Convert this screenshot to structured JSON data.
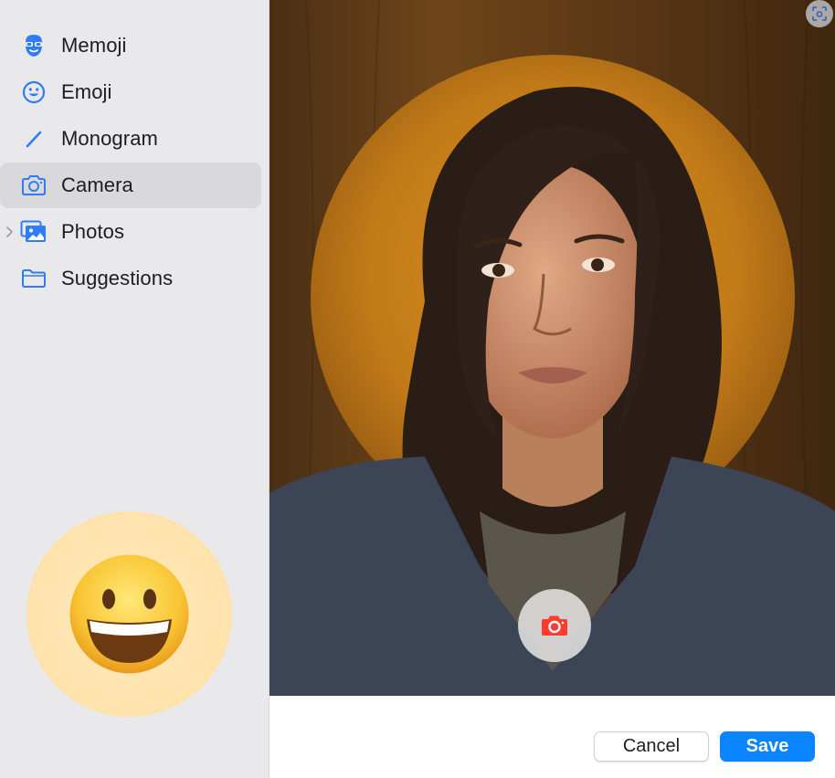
{
  "sidebar": {
    "items": [
      {
        "label": "Memoji",
        "icon": "memoji-icon"
      },
      {
        "label": "Emoji",
        "icon": "emoji-icon"
      },
      {
        "label": "Monogram",
        "icon": "pencil-icon"
      },
      {
        "label": "Camera",
        "icon": "camera-icon",
        "selected": true
      },
      {
        "label": "Photos",
        "icon": "photos-icon",
        "expandable": true
      },
      {
        "label": "Suggestions",
        "icon": "folder-icon"
      }
    ],
    "preview": {
      "icon": "grinning-face-emoji"
    }
  },
  "camera": {
    "corner_icon": "camera-frame-icon",
    "shutter_icon": "camera-shutter-icon"
  },
  "footer": {
    "cancel_label": "Cancel",
    "save_label": "Save"
  },
  "colors": {
    "accent": "#0a84ff",
    "icon_blue": "#2f7cf6",
    "shutter_red": "#ff3b30",
    "preview_background": "#ffe4b0"
  }
}
